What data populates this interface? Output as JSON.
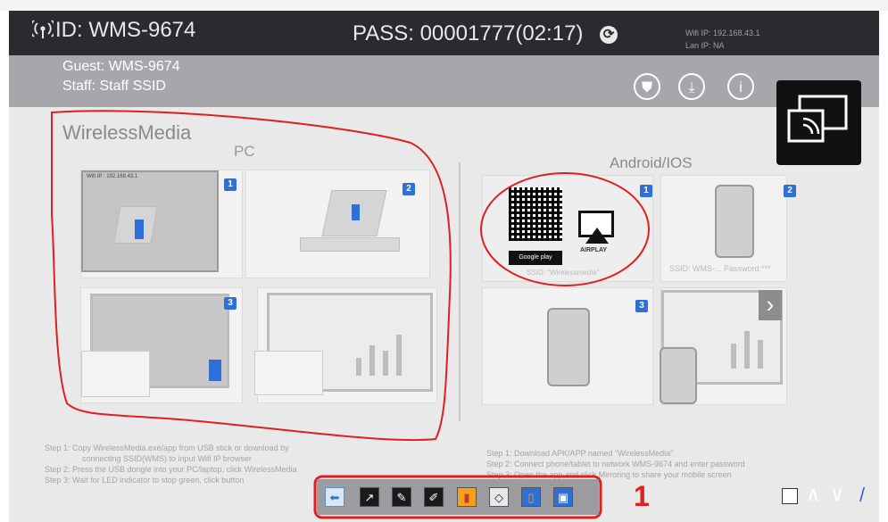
{
  "header": {
    "id_text": "ID: WMS-9674",
    "pass_text": "PASS: 00001777(02:17)",
    "wifi_ip": "Wifi IP: 192.168.43.1",
    "lan_ip": "Lan IP: NA"
  },
  "subheader": {
    "guest": "Guest: WMS-9674",
    "staff": "Staff: Staff SSID"
  },
  "icons": {
    "broadcast": "broadcast-icon",
    "refresh": "refresh-icon",
    "shield": "shield-icon",
    "download": "download-icon",
    "info": "info-icon",
    "cast": "cast-icon"
  },
  "content": {
    "title": "WirelessMedia",
    "pc_title": "PC",
    "android_title": "Android/IOS",
    "pc_panel_1_ip": "Wifi IP : 192.168.43.1",
    "airplay_label": "AIRPLAY",
    "google_play_label": "Google play",
    "ssid_label": "SSID: WMS-...  Password:***",
    "ios_label": "SSID: \"Wirelessmedia\"",
    "panel_numbers": [
      "1",
      "2",
      "3",
      "1",
      "2",
      "3"
    ]
  },
  "steps": {
    "pc": [
      "Step 1: Copy WirelessMedia.exe/app from USB stick or download by",
      "connecting SSID(WMS) to input Wifi IP browser",
      "Step 2: Press the USB dongle into your PC/laptop, click WirelessMedia",
      "Step 3: Wait for LED indicator to stop green, click button"
    ],
    "android": [
      "Step 1: Download APK/APP named \"WirelessMedia\"",
      "Step 2: Connect phone/tablet to network WMS-9674 and enter password",
      "Step 3: Open the app and click Mirroring to share your mobile screen"
    ]
  },
  "toolbar": {
    "tools": [
      {
        "name": "back-tool",
        "glyph": "⬅",
        "selected": true
      },
      {
        "name": "forward-tool",
        "glyph": "↗",
        "selected": false
      },
      {
        "name": "pen-tool",
        "glyph": "✎",
        "selected": false
      },
      {
        "name": "brush-tool",
        "glyph": "✐",
        "selected": false
      },
      {
        "name": "eraser-tool",
        "glyph": "▮",
        "selected": false
      },
      {
        "name": "shapes-tool",
        "glyph": "◇",
        "selected": false
      },
      {
        "name": "clear-tool",
        "glyph": "▯",
        "selected": false
      },
      {
        "name": "save-tool",
        "glyph": "▣",
        "selected": false
      }
    ],
    "annotation": "1"
  },
  "colors": {
    "header_bg": "#2b2b2f",
    "subheader_bg": "#a7a7ab",
    "content_bg": "#e9e9ea",
    "highlight_red": "#e02020",
    "badge_blue": "#2f6fd8"
  }
}
